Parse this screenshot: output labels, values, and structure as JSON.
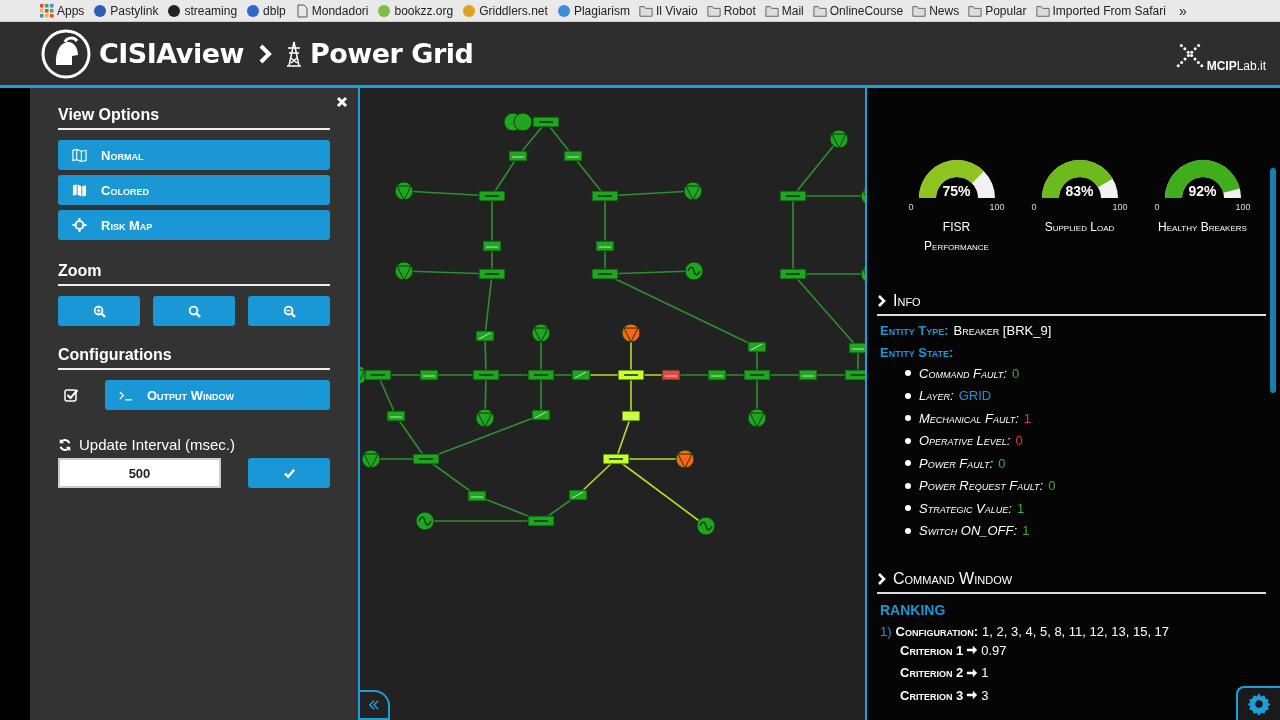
{
  "bookmarks": {
    "items": [
      {
        "kind": "apps",
        "label": "Apps"
      },
      {
        "kind": "site",
        "label": "Pastylink",
        "color": "#2b5fb4"
      },
      {
        "kind": "site",
        "label": "streaming",
        "color": "#222222"
      },
      {
        "kind": "site",
        "label": "dblp",
        "color": "#3366cc"
      },
      {
        "kind": "page",
        "label": "Mondadori"
      },
      {
        "kind": "site",
        "label": "bookzz.org",
        "color": "#7bbf4a"
      },
      {
        "kind": "site",
        "label": "Griddlers.net",
        "color": "#e0a020"
      },
      {
        "kind": "site",
        "label": "Plagiarism",
        "color": "#3a8fd8"
      },
      {
        "kind": "folder",
        "label": "Il Vivaio"
      },
      {
        "kind": "folder",
        "label": "Robot"
      },
      {
        "kind": "folder",
        "label": "Mail"
      },
      {
        "kind": "folder",
        "label": "OnlineCourse"
      },
      {
        "kind": "folder",
        "label": "News"
      },
      {
        "kind": "folder",
        "label": "Popular"
      },
      {
        "kind": "folder",
        "label": "Imported From Safari"
      }
    ],
    "more": "»"
  },
  "header": {
    "title": "CISIAview",
    "page": "Power Grid",
    "logo": "**MCIP**Lab.it"
  },
  "left_panel": {
    "view_options": {
      "title": "View Options",
      "buttons": [
        {
          "kind": "map-outline",
          "label": "Normal"
        },
        {
          "kind": "map",
          "label": "Colored"
        },
        {
          "kind": "crosshair",
          "label": "Risk Map"
        }
      ]
    },
    "zoom": {
      "title": "Zoom",
      "buttons": [
        {
          "kind": "zoom-in"
        },
        {
          "kind": "reset"
        },
        {
          "kind": "zoom-out"
        }
      ]
    },
    "configurations": {
      "title": "Configurations",
      "output_window": {
        "checked": true,
        "label": "Output Window"
      },
      "update_interval": {
        "label": "Update Interval (msec.)",
        "value": "500"
      }
    }
  },
  "gauges": [
    {
      "value": "75%",
      "level": 0.75,
      "color": "#8fc31f",
      "min": "0",
      "max": "100",
      "title": "FISR Performance"
    },
    {
      "value": "83%",
      "level": 0.83,
      "color": "#6cba1c",
      "min": "0",
      "max": "100",
      "title": "Supplied Load"
    },
    {
      "value": "92%",
      "level": 0.92,
      "color": "#3fae1a",
      "min": "0",
      "max": "100",
      "title": "Healthy Breakers"
    }
  ],
  "info": {
    "title": "Info",
    "entity_type": {
      "label": "Entity Type:",
      "value": "Breaker [BRK_9]"
    },
    "entity_state": {
      "label": "Entity State:",
      "items": [
        {
          "label": "Command Fault:",
          "value": "0",
          "color": "#3cae3c"
        },
        {
          "label": "Layer:",
          "value": "GRID",
          "color": "#1a97d5"
        },
        {
          "label": "Mechanical Fault:",
          "value": "1",
          "color": "#e53535"
        },
        {
          "label": "Operative Level:",
          "value": "0",
          "color": "#e53535"
        },
        {
          "label": "Power Fault:",
          "value": "0",
          "color": "#3cae3c"
        },
        {
          "label": "Power Request Fault:",
          "value": "0",
          "color": "#3cae3c"
        },
        {
          "label": "Strategic Value:",
          "value": "1",
          "color": "#3cae3c"
        },
        {
          "label": "Switch ON_OFF:",
          "value": "1",
          "color": "#3cae3c"
        }
      ]
    }
  },
  "command_window": {
    "title": "Command Window",
    "ranking": {
      "title": "RANKING",
      "entries": [
        {
          "index": "1)",
          "label": "Configuration:",
          "value": "1, 2, 3, 4, 5, 8, 11, 12, 13, 15, 17",
          "criteria": [
            {
              "label": "Criterion 1",
              "value": "0.97"
            },
            {
              "label": "Criterion 2",
              "value": "1"
            },
            {
              "label": "Criterion 3",
              "value": "3"
            }
          ]
        }
      ]
    }
  }
}
